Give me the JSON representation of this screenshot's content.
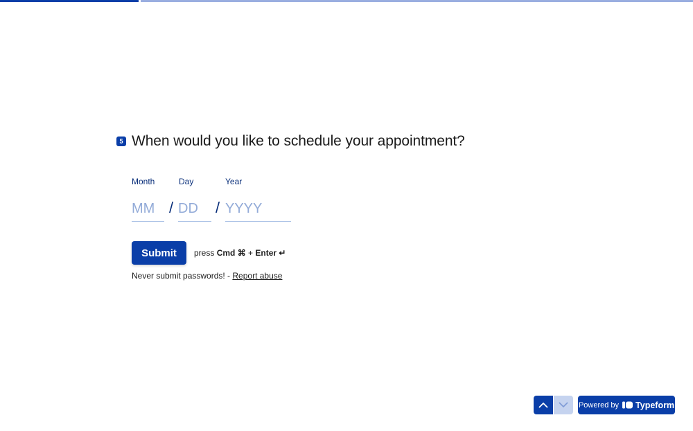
{
  "progress": {
    "fraction": 0.2,
    "accent": "#0a3ea8",
    "track": "#9aaee0"
  },
  "question": {
    "number": "5",
    "title": "When would you like to schedule your appointment?"
  },
  "date": {
    "month_label": "Month",
    "day_label": "Day",
    "year_label": "Year",
    "month_placeholder": "MM",
    "day_placeholder": "DD",
    "year_placeholder": "YYYY",
    "separator": "/"
  },
  "submit": {
    "label": "Submit",
    "hint_prefix": "press",
    "hint_key": "Cmd ⌘",
    "hint_plus": "+",
    "hint_enter": "Enter ↵"
  },
  "warning": {
    "text": "Never submit passwords! -",
    "link": "Report abuse"
  },
  "footer": {
    "up_icon": "chevron-up-icon",
    "down_icon": "chevron-down-icon",
    "powered_by": "Powered by",
    "brand": "Typeform"
  }
}
